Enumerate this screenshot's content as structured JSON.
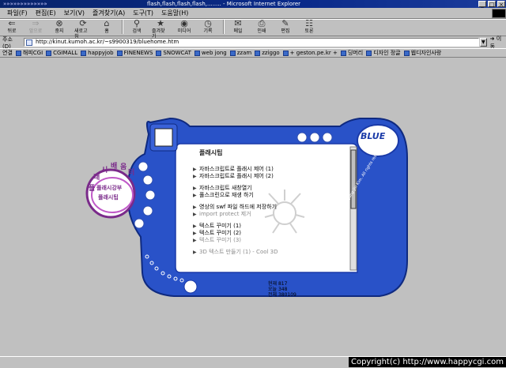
{
  "window": {
    "title_deco": "»»»»»»»»»»»»»",
    "title": "flash,flash,flash,flash,........ - Microsoft Internet Explorer",
    "min": "_",
    "max": "□",
    "close": "×"
  },
  "menu": [
    "파일(F)",
    "편집(E)",
    "보기(V)",
    "즐겨찾기(A)",
    "도구(T)",
    "도움말(H)"
  ],
  "toolbar": [
    {
      "label": "뒤로",
      "icon": "back-icon",
      "glyph": "⇐",
      "disabled": false
    },
    {
      "label": "앞으로",
      "icon": "forward-icon",
      "glyph": "⇒",
      "disabled": true
    },
    {
      "label": "중지",
      "icon": "stop-icon",
      "glyph": "⊗",
      "disabled": false
    },
    {
      "label": "새로고침",
      "icon": "refresh-icon",
      "glyph": "⟳",
      "disabled": false
    },
    {
      "label": "홈",
      "icon": "home-icon",
      "glyph": "⌂",
      "disabled": false
    },
    {
      "label": "검색",
      "icon": "search-icon",
      "glyph": "⚲",
      "disabled": false
    },
    {
      "label": "즐겨찾기",
      "icon": "favorites-icon",
      "glyph": "★",
      "disabled": false
    },
    {
      "label": "미디어",
      "icon": "media-icon",
      "glyph": "◉",
      "disabled": false
    },
    {
      "label": "기록",
      "icon": "history-icon",
      "glyph": "◷",
      "disabled": false
    },
    {
      "label": "메일",
      "icon": "mail-icon",
      "glyph": "✉",
      "disabled": false
    },
    {
      "label": "인쇄",
      "icon": "print-icon",
      "glyph": "⎙",
      "disabled": false
    },
    {
      "label": "편집",
      "icon": "edit-icon",
      "glyph": "✎",
      "disabled": false
    },
    {
      "label": "토론",
      "icon": "discuss-icon",
      "glyph": "☷",
      "disabled": false
    }
  ],
  "address": {
    "label": "주소(D)",
    "url": "http://kinut.kumoh.ac.kr/~s9900319/bluehome.htm",
    "go": "이동"
  },
  "links": {
    "label": "연결",
    "items": [
      "해피CGI",
      "CGIMALL",
      "happyjob",
      "FINENEWS",
      "SNOWCAT",
      "web jong",
      "zzam",
      "zziggo",
      "+ geston.pe.kr +",
      "딩머리",
      "디자인 정글",
      "웹디자인사랑"
    ]
  },
  "app": {
    "round_menu": [
      "플",
      "래",
      "시",
      "배",
      "움",
      "터"
    ],
    "center_label_1": "플래시강부",
    "center_label_2": "플래시팁",
    "panel_title": "플래시팁",
    "brand": "BLUE",
    "items": [
      {
        "text": "자바스크립트로 플래시 제어 (1)",
        "bold": false,
        "dim": false
      },
      {
        "text": "자바스크립트로 플래시 제어 (2)",
        "bold": false,
        "dim": false
      },
      {
        "text": "자바스크립트 새창열기",
        "bold": false,
        "dim": false
      },
      {
        "text": "풀스크린으로 재생 하기",
        "bold": false,
        "dim": false
      },
      {
        "text": "영상의 swf 파일 하드에 저장하기",
        "bold": false,
        "dim": false
      },
      {
        "text": "import protect 제거",
        "bold": false,
        "dim": true
      },
      {
        "text": "텍스트 꾸미기 (1)",
        "bold": false,
        "dim": false
      },
      {
        "text": "텍스트 꾸미기 (2)",
        "bold": false,
        "dim": false
      },
      {
        "text": "텍스트 꾸미기 (3)",
        "bold": false,
        "dim": true
      },
      {
        "text": "3D 텍스트 만들기 (1) - Cool 3D",
        "bold": false,
        "dim": true
      }
    ],
    "counter": [
      "현재 817",
      "오늘 348",
      "전체 380109"
    ],
    "side_copyright": "Copyright (C) 1999, 2000 by Jung-Jin Kim. All rights reserved."
  },
  "watermark": "Copyright(c) http://www.happycgi.com"
}
